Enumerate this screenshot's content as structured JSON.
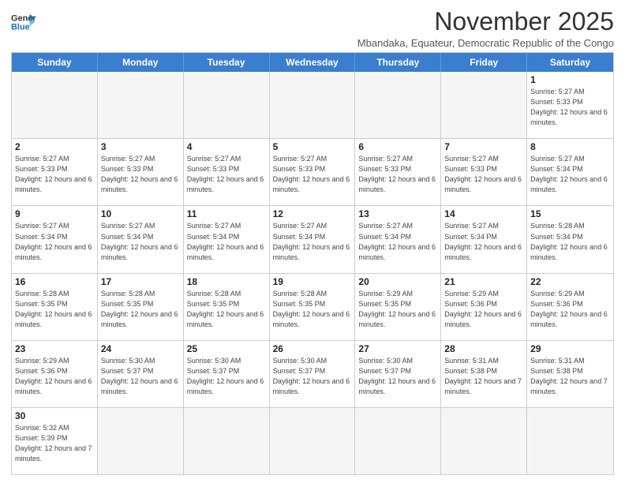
{
  "header": {
    "logo_line1": "General",
    "logo_line2": "Blue",
    "month_title": "November 2025",
    "location": "Mbandaka, Equateur, Democratic Republic of the Congo"
  },
  "weekdays": [
    "Sunday",
    "Monday",
    "Tuesday",
    "Wednesday",
    "Thursday",
    "Friday",
    "Saturday"
  ],
  "rows": [
    [
      {
        "day": "",
        "info": ""
      },
      {
        "day": "",
        "info": ""
      },
      {
        "day": "",
        "info": ""
      },
      {
        "day": "",
        "info": ""
      },
      {
        "day": "",
        "info": ""
      },
      {
        "day": "",
        "info": ""
      },
      {
        "day": "1",
        "info": "Sunrise: 5:27 AM\nSunset: 5:33 PM\nDaylight: 12 hours and 6 minutes."
      }
    ],
    [
      {
        "day": "2",
        "info": "Sunrise: 5:27 AM\nSunset: 5:33 PM\nDaylight: 12 hours and 6 minutes."
      },
      {
        "day": "3",
        "info": "Sunrise: 5:27 AM\nSunset: 5:33 PM\nDaylight: 12 hours and 6 minutes."
      },
      {
        "day": "4",
        "info": "Sunrise: 5:27 AM\nSunset: 5:33 PM\nDaylight: 12 hours and 6 minutes."
      },
      {
        "day": "5",
        "info": "Sunrise: 5:27 AM\nSunset: 5:33 PM\nDaylight: 12 hours and 6 minutes."
      },
      {
        "day": "6",
        "info": "Sunrise: 5:27 AM\nSunset: 5:33 PM\nDaylight: 12 hours and 6 minutes."
      },
      {
        "day": "7",
        "info": "Sunrise: 5:27 AM\nSunset: 5:33 PM\nDaylight: 12 hours and 6 minutes."
      },
      {
        "day": "8",
        "info": "Sunrise: 5:27 AM\nSunset: 5:34 PM\nDaylight: 12 hours and 6 minutes."
      }
    ],
    [
      {
        "day": "9",
        "info": "Sunrise: 5:27 AM\nSunset: 5:34 PM\nDaylight: 12 hours and 6 minutes."
      },
      {
        "day": "10",
        "info": "Sunrise: 5:27 AM\nSunset: 5:34 PM\nDaylight: 12 hours and 6 minutes."
      },
      {
        "day": "11",
        "info": "Sunrise: 5:27 AM\nSunset: 5:34 PM\nDaylight: 12 hours and 6 minutes."
      },
      {
        "day": "12",
        "info": "Sunrise: 5:27 AM\nSunset: 5:34 PM\nDaylight: 12 hours and 6 minutes."
      },
      {
        "day": "13",
        "info": "Sunrise: 5:27 AM\nSunset: 5:34 PM\nDaylight: 12 hours and 6 minutes."
      },
      {
        "day": "14",
        "info": "Sunrise: 5:27 AM\nSunset: 5:34 PM\nDaylight: 12 hours and 6 minutes."
      },
      {
        "day": "15",
        "info": "Sunrise: 5:28 AM\nSunset: 5:34 PM\nDaylight: 12 hours and 6 minutes."
      }
    ],
    [
      {
        "day": "16",
        "info": "Sunrise: 5:28 AM\nSunset: 5:35 PM\nDaylight: 12 hours and 6 minutes."
      },
      {
        "day": "17",
        "info": "Sunrise: 5:28 AM\nSunset: 5:35 PM\nDaylight: 12 hours and 6 minutes."
      },
      {
        "day": "18",
        "info": "Sunrise: 5:28 AM\nSunset: 5:35 PM\nDaylight: 12 hours and 6 minutes."
      },
      {
        "day": "19",
        "info": "Sunrise: 5:28 AM\nSunset: 5:35 PM\nDaylight: 12 hours and 6 minutes."
      },
      {
        "day": "20",
        "info": "Sunrise: 5:29 AM\nSunset: 5:35 PM\nDaylight: 12 hours and 6 minutes."
      },
      {
        "day": "21",
        "info": "Sunrise: 5:29 AM\nSunset: 5:36 PM\nDaylight: 12 hours and 6 minutes."
      },
      {
        "day": "22",
        "info": "Sunrise: 5:29 AM\nSunset: 5:36 PM\nDaylight: 12 hours and 6 minutes."
      }
    ],
    [
      {
        "day": "23",
        "info": "Sunrise: 5:29 AM\nSunset: 5:36 PM\nDaylight: 12 hours and 6 minutes."
      },
      {
        "day": "24",
        "info": "Sunrise: 5:30 AM\nSunset: 5:37 PM\nDaylight: 12 hours and 6 minutes."
      },
      {
        "day": "25",
        "info": "Sunrise: 5:30 AM\nSunset: 5:37 PM\nDaylight: 12 hours and 6 minutes."
      },
      {
        "day": "26",
        "info": "Sunrise: 5:30 AM\nSunset: 5:37 PM\nDaylight: 12 hours and 6 minutes."
      },
      {
        "day": "27",
        "info": "Sunrise: 5:30 AM\nSunset: 5:37 PM\nDaylight: 12 hours and 6 minutes."
      },
      {
        "day": "28",
        "info": "Sunrise: 5:31 AM\nSunset: 5:38 PM\nDaylight: 12 hours and 7 minutes."
      },
      {
        "day": "29",
        "info": "Sunrise: 5:31 AM\nSunset: 5:38 PM\nDaylight: 12 hours and 7 minutes."
      }
    ],
    [
      {
        "day": "30",
        "info": "Sunrise: 5:32 AM\nSunset: 5:39 PM\nDaylight: 12 hours and 7 minutes."
      },
      {
        "day": "",
        "info": ""
      },
      {
        "day": "",
        "info": ""
      },
      {
        "day": "",
        "info": ""
      },
      {
        "day": "",
        "info": ""
      },
      {
        "day": "",
        "info": ""
      },
      {
        "day": "",
        "info": ""
      }
    ]
  ]
}
